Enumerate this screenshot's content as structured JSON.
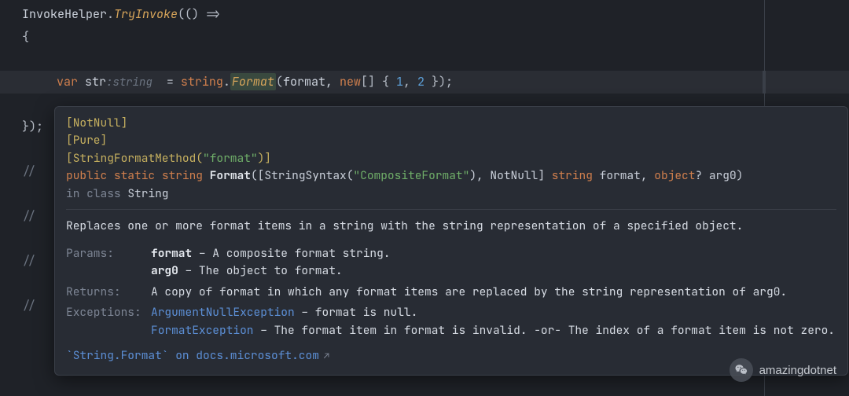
{
  "code": {
    "line1_type": "InvokeHelper",
    "line1_dot": ".",
    "line1_method": "TryInvoke",
    "line1_rest": "(() =>",
    "line2": "{",
    "line3_kw": "var",
    "line3_sp1": " ",
    "line3_var": "str",
    "line3_hint": ":string",
    "line3_eq": "  = ",
    "line3_string": "string",
    "line3_dot": ".",
    "line3_format": "Format",
    "line3_open": "(",
    "line3_arg1": "format, ",
    "line3_new": "new",
    "line3_arr": "[] { ",
    "line3_n1": "1",
    "line3_comma": ", ",
    "line3_n2": "2",
    "line3_close": " });",
    "line5": "});",
    "comment": "//"
  },
  "tooltip": {
    "annot1": "[NotNull]",
    "annot2": "[Pure]",
    "annot3_pre": "[StringFormatMethod(",
    "annot3_str": "\"format\"",
    "annot3_post": ")]",
    "sig_public": "public",
    "sig_static": "static",
    "sig_string": "string",
    "sig_name": "Format",
    "sig_open": "([StringSyntax(",
    "sig_comp": "\"CompositeFormat\"",
    "sig_mid": "), NotNull] ",
    "sig_ptype": "string",
    "sig_pname": " format, ",
    "sig_otype": "object",
    "sig_q": "? ",
    "sig_a0": "arg0)",
    "in_class_pre": "in class ",
    "in_class": "String",
    "summary": "Replaces one or more format items in a string with the string representation of a specified object.",
    "label_params": "Params:",
    "param1_name": "format",
    "param1_desc": " – A composite format string.",
    "param2_name": "arg0",
    "param2_desc": " – The object to format.",
    "label_returns": "Returns:",
    "returns_text": "A copy of format in which any format items are replaced by the string representation of arg0.",
    "label_exceptions": "Exceptions:",
    "exc1": "ArgumentNullException",
    "exc1_desc": " – format is null.",
    "exc2": "FormatException",
    "exc2_desc": " – The format item in format is invalid. -or- The index of a format item is not zero.",
    "ext_link": "`String.Format` on docs.microsoft.com",
    "ext_arrow": "↗"
  },
  "watermark": {
    "text": "amazingdotnet"
  }
}
